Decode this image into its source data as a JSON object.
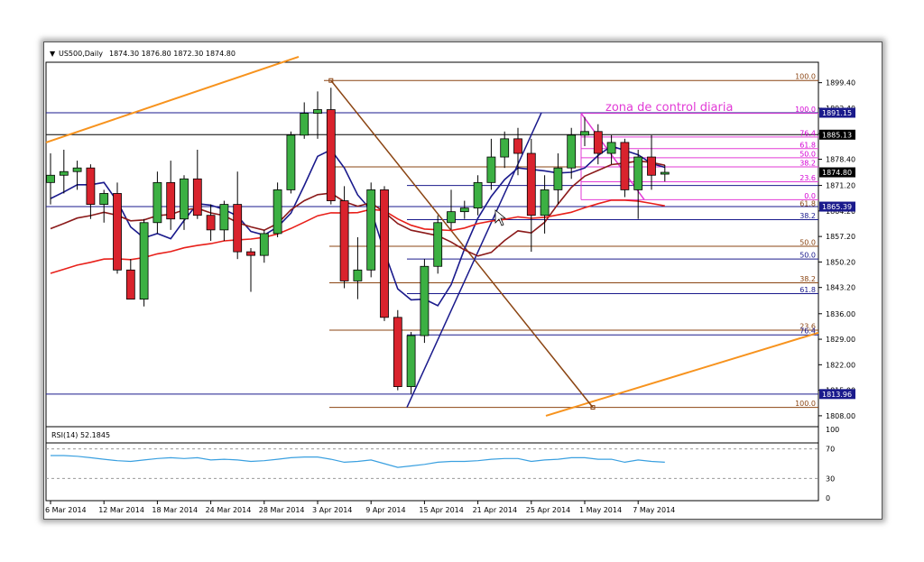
{
  "chart_data": {
    "type": "candlestick",
    "symbol_header": "US500,Daily",
    "header_ohlc": "1874.30 1876.80 1872.30 1874.80",
    "price_axis": {
      "ymin": 1805.5,
      "ymax": 1905.5,
      "ticks": [
        "1899.40",
        "1892.40",
        "1885.40",
        "1878.40",
        "1871.20",
        "1864.20",
        "1857.20",
        "1850.20",
        "1843.20",
        "1836.00",
        "1829.00",
        "1822.00",
        "1815.00",
        "1808.00"
      ],
      "tick_values": [
        1899.4,
        1892.4,
        1885.4,
        1878.4,
        1871.2,
        1864.2,
        1857.2,
        1850.2,
        1843.2,
        1836.0,
        1829.0,
        1822.0,
        1815.0,
        1808.0
      ]
    },
    "price_tags": [
      {
        "label": "1891.15",
        "value": 1891.15,
        "color": "#1a1a8c"
      },
      {
        "label": "1885.13",
        "value": 1885.13,
        "color": "#000000"
      },
      {
        "label": "1874.80",
        "value": 1874.8,
        "color": "#000000"
      },
      {
        "label": "1865.39",
        "value": 1865.39,
        "color": "#1a1a8c"
      },
      {
        "label": "1813.96",
        "value": 1813.96,
        "color": "#1a1a8c"
      }
    ],
    "x_labels": [
      "6 Mar 2014",
      "12 Mar 2014",
      "18 Mar 2014",
      "24 Mar 2014",
      "28 Mar 2014",
      "3 Apr 2014",
      "9 Apr 2014",
      "15 Apr 2014",
      "21 Apr 2014",
      "25 Apr 2014",
      "1 May 2014",
      "7 May 2014"
    ],
    "x_label_index": [
      0,
      4,
      8,
      12,
      16,
      20,
      24,
      28,
      32,
      36,
      40,
      44
    ],
    "candles": [
      {
        "o": 1872,
        "h": 1880,
        "l": 1866,
        "c": 1874
      },
      {
        "o": 1874,
        "h": 1881,
        "l": 1869,
        "c": 1875
      },
      {
        "o": 1875,
        "h": 1878,
        "l": 1870,
        "c": 1876
      },
      {
        "o": 1876,
        "h": 1877,
        "l": 1862,
        "c": 1866
      },
      {
        "o": 1866,
        "h": 1870,
        "l": 1861,
        "c": 1869
      },
      {
        "o": 1869,
        "h": 1872,
        "l": 1847,
        "c": 1848
      },
      {
        "o": 1848,
        "h": 1851,
        "l": 1840,
        "c": 1840
      },
      {
        "o": 1840,
        "h": 1862,
        "l": 1838,
        "c": 1861
      },
      {
        "o": 1861,
        "h": 1875,
        "l": 1858,
        "c": 1872
      },
      {
        "o": 1872,
        "h": 1878,
        "l": 1859,
        "c": 1862
      },
      {
        "o": 1862,
        "h": 1874,
        "l": 1859,
        "c": 1873
      },
      {
        "o": 1873,
        "h": 1881,
        "l": 1862,
        "c": 1863
      },
      {
        "o": 1863,
        "h": 1866,
        "l": 1856,
        "c": 1859
      },
      {
        "o": 1859,
        "h": 1867,
        "l": 1856,
        "c": 1866
      },
      {
        "o": 1866,
        "h": 1875,
        "l": 1851,
        "c": 1853
      },
      {
        "o": 1853,
        "h": 1854,
        "l": 1842,
        "c": 1852
      },
      {
        "o": 1852,
        "h": 1859,
        "l": 1850,
        "c": 1858
      },
      {
        "o": 1858,
        "h": 1872,
        "l": 1857,
        "c": 1870
      },
      {
        "o": 1870,
        "h": 1886,
        "l": 1869,
        "c": 1885
      },
      {
        "o": 1885,
        "h": 1894,
        "l": 1884,
        "c": 1891
      },
      {
        "o": 1891,
        "h": 1897,
        "l": 1884,
        "c": 1892
      },
      {
        "o": 1892,
        "h": 1898,
        "l": 1866,
        "c": 1867
      },
      {
        "o": 1867,
        "h": 1871,
        "l": 1843,
        "c": 1845
      },
      {
        "o": 1845,
        "h": 1857,
        "l": 1840,
        "c": 1848
      },
      {
        "o": 1848,
        "h": 1872,
        "l": 1846,
        "c": 1870
      },
      {
        "o": 1870,
        "h": 1871,
        "l": 1834,
        "c": 1835
      },
      {
        "o": 1835,
        "h": 1837,
        "l": 1815,
        "c": 1816
      },
      {
        "o": 1816,
        "h": 1831,
        "l": 1814,
        "c": 1830
      },
      {
        "o": 1830,
        "h": 1851,
        "l": 1828,
        "c": 1849
      },
      {
        "o": 1849,
        "h": 1863,
        "l": 1847,
        "c": 1861
      },
      {
        "o": 1861,
        "h": 1870,
        "l": 1859,
        "c": 1864
      },
      {
        "o": 1864,
        "h": 1867,
        "l": 1862,
        "c": 1865
      },
      {
        "o": 1865,
        "h": 1874,
        "l": 1863,
        "c": 1872
      },
      {
        "o": 1872,
        "h": 1884,
        "l": 1870,
        "c": 1879
      },
      {
        "o": 1879,
        "h": 1886,
        "l": 1876,
        "c": 1884
      },
      {
        "o": 1884,
        "h": 1887,
        "l": 1874,
        "c": 1880
      },
      {
        "o": 1880,
        "h": 1884,
        "l": 1853,
        "c": 1863
      },
      {
        "o": 1863,
        "h": 1874,
        "l": 1858,
        "c": 1870
      },
      {
        "o": 1870,
        "h": 1880,
        "l": 1866,
        "c": 1876
      },
      {
        "o": 1876,
        "h": 1887,
        "l": 1873,
        "c": 1885
      },
      {
        "o": 1885,
        "h": 1890,
        "l": 1882,
        "c": 1886
      },
      {
        "o": 1886,
        "h": 1888,
        "l": 1877,
        "c": 1880
      },
      {
        "o": 1880,
        "h": 1885,
        "l": 1877,
        "c": 1883
      },
      {
        "o": 1883,
        "h": 1884,
        "l": 1868,
        "c": 1870
      },
      {
        "o": 1870,
        "h": 1881,
        "l": 1862,
        "c": 1879
      },
      {
        "o": 1879,
        "h": 1885,
        "l": 1870,
        "c": 1874
      },
      {
        "o": 1874.3,
        "h": 1876.8,
        "l": 1872.3,
        "c": 1874.8
      }
    ],
    "fib_labels": [
      {
        "label": "100.0",
        "value": 1900.0,
        "color": "#8b4513"
      },
      {
        "label": "100.0",
        "value": 1891.0,
        "color": "#d400d4"
      },
      {
        "label": "76.4",
        "value": 1884.5,
        "color": "#d400d4"
      },
      {
        "label": "61.8",
        "value": 1881.3,
        "color": "#d400d4"
      },
      {
        "label": "50.0",
        "value": 1878.8,
        "color": "#d400d4"
      },
      {
        "label": "38.2",
        "value": 1876.3,
        "color": "#d400d4"
      },
      {
        "label": "23.6",
        "value": 1872.2,
        "color": "#d400d4"
      },
      {
        "label": "0.0",
        "value": 1867.3,
        "color": "#d400d4"
      },
      {
        "label": "61.8",
        "value": 1865.2,
        "color": "#8b4513"
      },
      {
        "label": "38.2",
        "value": 1861.8,
        "color": "#1a1a8c"
      },
      {
        "label": "50.0",
        "value": 1854.5,
        "color": "#8b4513"
      },
      {
        "label": "50.0",
        "value": 1851.0,
        "color": "#1a1a8c"
      },
      {
        "label": "38.2",
        "value": 1844.5,
        "color": "#8b4513"
      },
      {
        "label": "61.8",
        "value": 1841.5,
        "color": "#1a1a8c"
      },
      {
        "label": "23.6",
        "value": 1831.5,
        "color": "#8b4513"
      },
      {
        "label": "76.4",
        "value": 1830.2,
        "color": "#1a1a8c"
      },
      {
        "label": "100.0",
        "value": 1810.3,
        "color": "#8b4513"
      }
    ],
    "annotation": "zona de control diaria",
    "rsi": {
      "title": "RSI(14) 52.1845",
      "ylim": [
        0,
        100
      ],
      "ticks": [
        "100",
        "70",
        "30",
        "0"
      ],
      "tick_values": [
        100,
        70,
        30,
        0
      ],
      "values": [
        61,
        61,
        60,
        58,
        56,
        54,
        53,
        55,
        57,
        58,
        57,
        58,
        55,
        56,
        55,
        53,
        54,
        56,
        58,
        59,
        59,
        56,
        52,
        53,
        55,
        50,
        45,
        47,
        49,
        52,
        53,
        53,
        54,
        56,
        57,
        57,
        53,
        55,
        56,
        58,
        58,
        56,
        56,
        52,
        55,
        53,
        52
      ]
    },
    "colors": {
      "bull": "#3cb043",
      "bear": "#d9232d",
      "ma_fast": "#1a1a8c",
      "ma_mid": "#8b1a1a",
      "ma_slow": "#e8201a",
      "trend_orange": "#f7931e",
      "fib_brown": "#8b4513",
      "fib_blue": "#1a1a8c",
      "zone_pink": "#e23ad6",
      "rsi_line": "#3aa0e0"
    }
  }
}
